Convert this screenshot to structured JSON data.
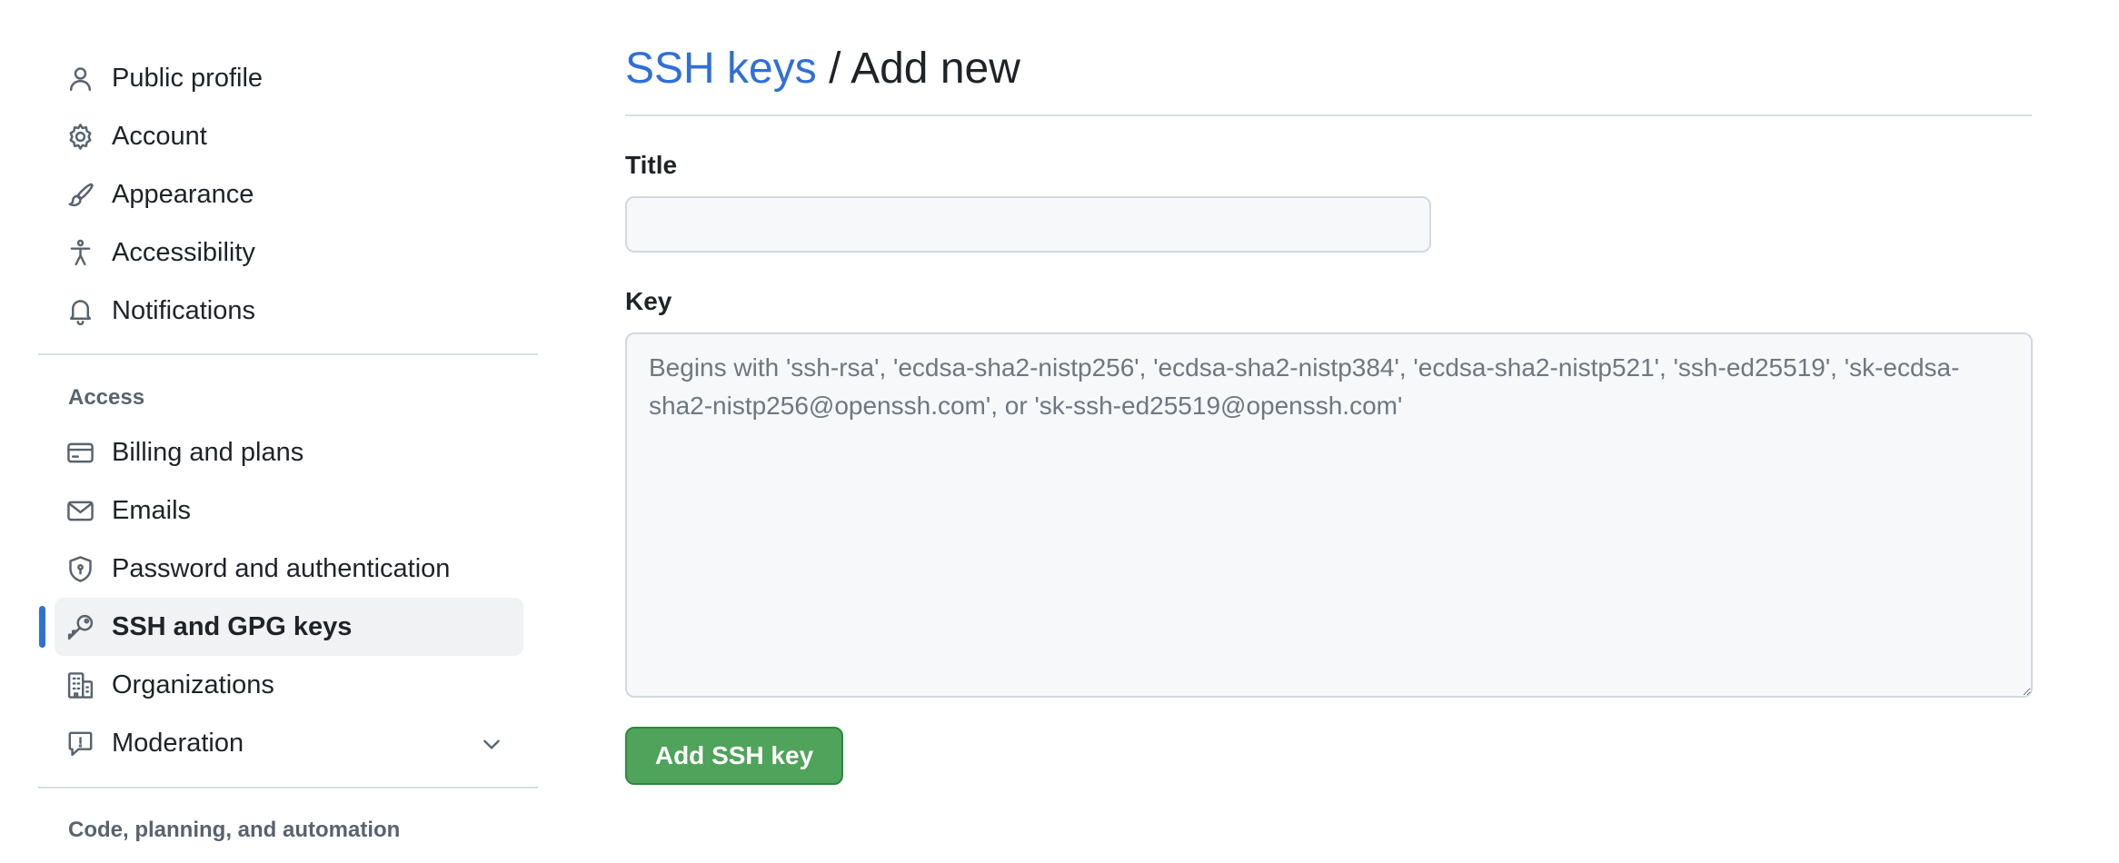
{
  "sidebar": {
    "items_top": [
      {
        "label": "Public profile",
        "icon": "person-icon"
      },
      {
        "label": "Account",
        "icon": "gear-icon"
      },
      {
        "label": "Appearance",
        "icon": "paintbrush-icon"
      },
      {
        "label": "Accessibility",
        "icon": "accessibility-icon"
      },
      {
        "label": "Notifications",
        "icon": "bell-icon"
      }
    ],
    "access_heading": "Access",
    "items_access": [
      {
        "label": "Billing and plans",
        "icon": "credit-card-icon"
      },
      {
        "label": "Emails",
        "icon": "mail-icon"
      },
      {
        "label": "Password and authentication",
        "icon": "shield-lock-icon"
      },
      {
        "label": "SSH and GPG keys",
        "icon": "key-icon",
        "selected": true
      },
      {
        "label": "Organizations",
        "icon": "organization-icon"
      },
      {
        "label": "Moderation",
        "icon": "report-icon",
        "expandable": true
      }
    ],
    "code_heading": "Code, planning, and automation"
  },
  "main": {
    "breadcrumb_link": "SSH keys",
    "title_suffix": " / Add new",
    "title_label": "Title",
    "title_value": "",
    "key_label": "Key",
    "key_placeholder": "Begins with 'ssh-rsa', 'ecdsa-sha2-nistp256', 'ecdsa-sha2-nistp384', 'ecdsa-sha2-nistp521', 'ssh-ed25519', 'sk-ecdsa-sha2-nistp256@openssh.com', or 'sk-ssh-ed25519@openssh.com'",
    "submit_label": "Add SSH key"
  },
  "colors": {
    "accent": "#2f6fd8",
    "button_green": "#4fa35a",
    "selected_bg": "#f0f2f4",
    "text": "#1f2328",
    "muted": "#59636e"
  }
}
